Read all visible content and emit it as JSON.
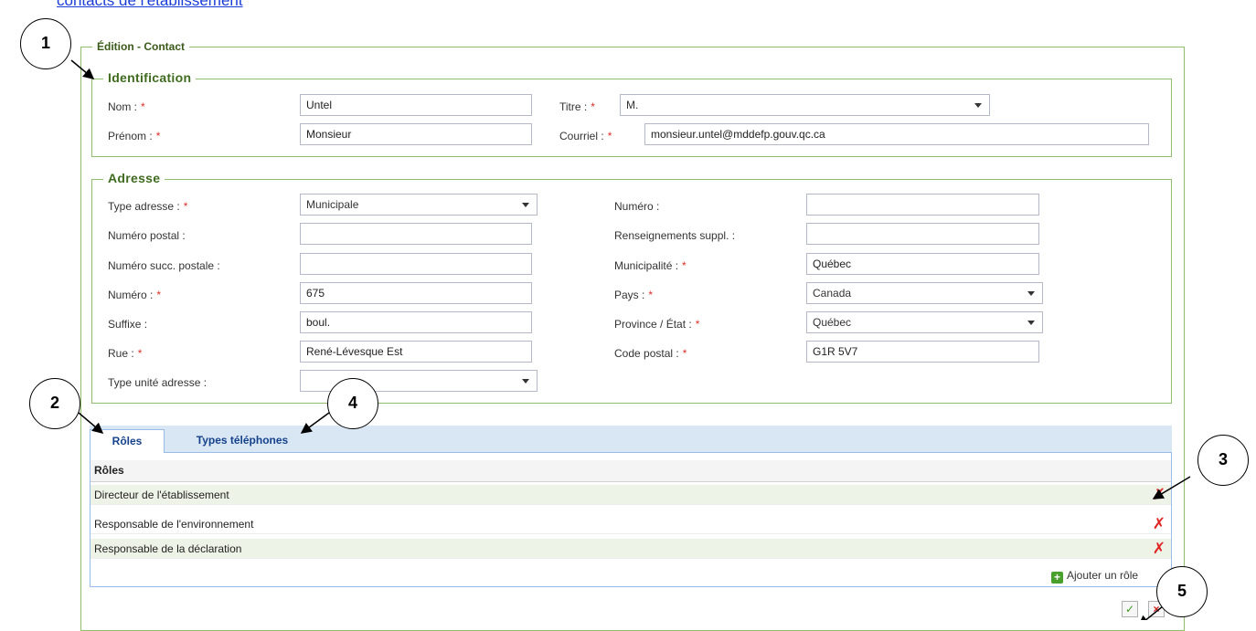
{
  "page": {
    "top_link": "contacts de l'établissement"
  },
  "edition": {
    "legend": "Édition - Contact",
    "identification": {
      "legend": "Identification",
      "nom_label": "Nom :",
      "nom_value": "Untel",
      "prenom_label": "Prénom :",
      "prenom_value": "Monsieur",
      "titre_label": "Titre :",
      "titre_value": "M.",
      "courriel_label": "Courriel :",
      "courriel_value": "monsieur.untel@mddefp.gouv.qc.ca"
    },
    "adresse": {
      "legend": "Adresse",
      "type_adresse_label": "Type adresse :",
      "type_adresse_value": "Municipale",
      "numero_postal_label": "Numéro postal :",
      "numero_postal_value": "",
      "numero_succ_label": "Numéro succ. postale :",
      "numero_succ_value": "",
      "numero_label": "Numéro :",
      "numero_value": "675",
      "suffixe_label": "Suffixe :",
      "suffixe_value": "boul.",
      "rue_label": "Rue :",
      "rue_value": "René-Lévesque Est",
      "type_unite_label": "Type unité adresse :",
      "type_unite_value": "",
      "numero2_label": "Numéro :",
      "numero2_value": "",
      "renseignements_label": "Renseignements suppl. :",
      "renseignements_value": "",
      "municipalite_label": "Municipalité :",
      "municipalite_value": "Québec",
      "pays_label": "Pays :",
      "pays_value": "Canada",
      "province_label": "Province / État :",
      "province_value": "Québec",
      "code_postal_label": "Code postal :",
      "code_postal_value": "G1R 5V7"
    },
    "required_mark": "*"
  },
  "tabs": [
    {
      "label": "Rôles",
      "active": true
    },
    {
      "label": "Types téléphones",
      "active": false
    }
  ],
  "grid": {
    "header": "Rôles",
    "rows": [
      {
        "label": "Directeur de l'établissement"
      },
      {
        "label": "Responsable de l'environnement"
      },
      {
        "label": "Responsable de la déclaration"
      }
    ],
    "delete_icon": "delete-x-icon",
    "add_label": "Ajouter un rôle"
  },
  "actions": {
    "confirm_icon": "check-icon",
    "cancel_icon": "close-icon"
  },
  "callouts": [
    "1",
    "2",
    "3",
    "4",
    "5"
  ],
  "colors": {
    "fieldset_border": "#8fbf6b",
    "legend_green": "#3f6b1f",
    "required_red": "#d9302b",
    "tab_blue": "#15428b",
    "row_alt": "#edf3e6",
    "delete_red": "#e02424"
  }
}
